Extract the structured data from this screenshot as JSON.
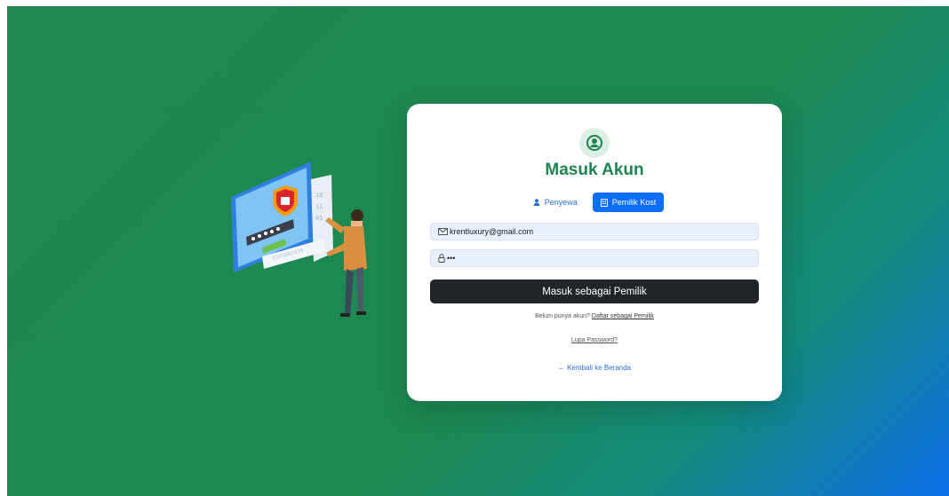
{
  "login": {
    "title": "Masuk Akun",
    "tabs": [
      {
        "label": "Penyewa",
        "icon": "user-icon",
        "active": false
      },
      {
        "label": "Pemilik Kost",
        "icon": "building-icon",
        "active": true
      }
    ],
    "email_value": "krentluxury@gmail.com",
    "password_value": "•••",
    "submit_label": "Masuk sebagai Pemilik",
    "register_prompt": "Belum punya akun?",
    "register_link": "Daftar sebagai Pemilik",
    "forgot_link": "Lupa Password?",
    "back_link": "← Kembali ke Beranda"
  },
  "colors": {
    "brand_green": "#1e8550",
    "primary_blue": "#0d6efd",
    "dark_button": "#212529"
  }
}
